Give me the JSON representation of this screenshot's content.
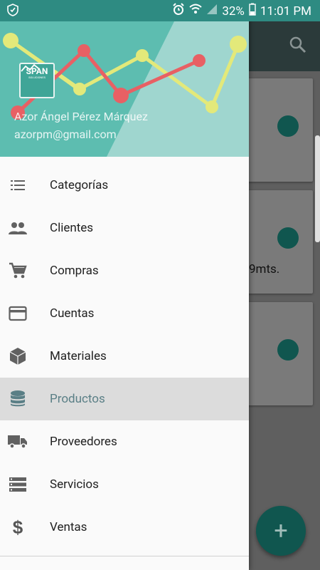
{
  "status_bar": {
    "battery": "32%",
    "time": "11:01 PM"
  },
  "drawer": {
    "logo_text": "SPAN",
    "logo_subtext": "SOLUCIONES",
    "user_name": "Azor Ángel Pérez Márquez",
    "user_email": "azorpm@gmail.com",
    "items": [
      {
        "label": "Categorías",
        "icon": "list-icon"
      },
      {
        "label": "Clientes",
        "icon": "people-icon"
      },
      {
        "label": "Compras",
        "icon": "cart-icon"
      },
      {
        "label": "Cuentas",
        "icon": "credit-card-icon"
      },
      {
        "label": "Materiales",
        "icon": "box-icon"
      },
      {
        "label": "Productos",
        "icon": "database-icon",
        "active": true
      },
      {
        "label": "Proveedores",
        "icon": "truck-icon"
      },
      {
        "label": "Servicios",
        "icon": "storage-icon"
      },
      {
        "label": "Ventas",
        "icon": "dollar-icon"
      }
    ]
  },
  "background": {
    "card_text": "9mts.",
    "fab_label": "+"
  },
  "colors": {
    "primary": "#5dbdb0",
    "status_bar": "#2e8b82",
    "accent_dark": "#10564f",
    "active_item": "#dcdcdc"
  }
}
